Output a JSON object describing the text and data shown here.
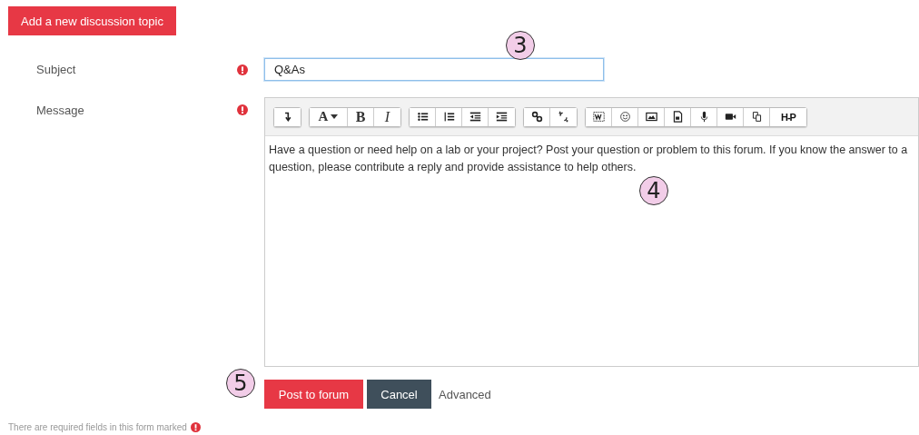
{
  "add_button": {
    "label": "Add a new discussion topic"
  },
  "subject": {
    "label": "Subject",
    "required": true,
    "value": "Q&As"
  },
  "message": {
    "label": "Message",
    "required": true,
    "toolbar": [
      [
        {
          "kind": "collapse"
        }
      ],
      [
        {
          "kind": "font",
          "label": "A"
        },
        {
          "kind": "bold",
          "label": "B"
        },
        {
          "kind": "italic",
          "label": "I"
        }
      ],
      [
        {
          "kind": "bullets"
        },
        {
          "kind": "numbers"
        },
        {
          "kind": "outdent"
        },
        {
          "kind": "indent"
        }
      ],
      [
        {
          "kind": "link"
        },
        {
          "kind": "unlink"
        }
      ],
      [
        {
          "kind": "word"
        },
        {
          "kind": "emoji"
        },
        {
          "kind": "image"
        },
        {
          "kind": "media"
        },
        {
          "kind": "mic"
        },
        {
          "kind": "video"
        },
        {
          "kind": "copy"
        },
        {
          "kind": "h5p",
          "label": "H-P"
        }
      ]
    ],
    "body": "Have a question or need help on a lab or your project? Post your question or problem to this forum. If you know the answer to a question, please contribute a reply and provide assistance to help others."
  },
  "actions": {
    "post": "Post to forum",
    "cancel": "Cancel",
    "advanced": "Advanced"
  },
  "footer": "There are required fields in this form marked",
  "callouts": {
    "subject": "3",
    "editor": "4",
    "actions": "5"
  }
}
